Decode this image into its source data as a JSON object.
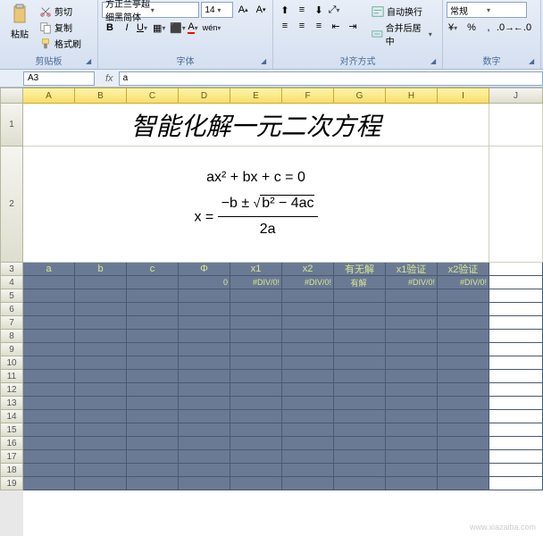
{
  "ribbon": {
    "clipboard": {
      "label": "剪贴板",
      "paste": "粘贴",
      "cut": "剪切",
      "copy": "复制",
      "format": "格式刷"
    },
    "font": {
      "label": "字体",
      "family": "方正兰亭超细黑简体",
      "size": "14"
    },
    "align": {
      "label": "对齐方式",
      "wrap": "自动换行",
      "merge": "合并后居中"
    },
    "number": {
      "label": "数字",
      "format": "常规"
    }
  },
  "cellref": "A3",
  "formula": "a",
  "cols": [
    "A",
    "B",
    "C",
    "D",
    "E",
    "F",
    "G",
    "H",
    "I",
    "J"
  ],
  "rows": [
    "1",
    "2",
    "3",
    "4",
    "5",
    "6",
    "7",
    "8",
    "9",
    "10",
    "11",
    "12",
    "13",
    "14",
    "15",
    "16",
    "17",
    "18",
    "19"
  ],
  "title": "智能化解一元二次方程",
  "eq1": "ax² + bx + c = 0",
  "eq2": {
    "lhs": "x =",
    "numtop": "−b ± √(b² − 4ac)",
    "numbot": "2a"
  },
  "headers": [
    "a",
    "b",
    "c",
    "Φ",
    "x1",
    "x2",
    "有无解",
    "x1验证",
    "x2验证"
  ],
  "row4": [
    "",
    "",
    "",
    "0",
    "#DIV/0!",
    "#DIV/0!",
    "有解",
    "#DIV/0!",
    "#DIV/0!"
  ],
  "watermark": "www.xiazaiba.com"
}
